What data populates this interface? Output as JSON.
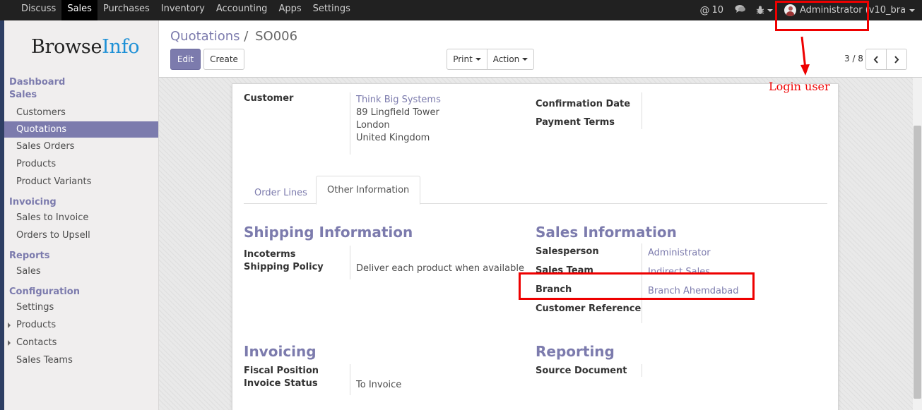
{
  "topbar": {
    "menu": [
      "Discuss",
      "Sales",
      "Purchases",
      "Inventory",
      "Accounting",
      "Apps",
      "Settings"
    ],
    "active_menu": "Sales",
    "mentions_count": "10",
    "user_name": "Administrator (v10_bra…"
  },
  "brand": {
    "part1": "Browse",
    "part2": "Info"
  },
  "sidebar": {
    "sections": [
      {
        "title": "Dashboard",
        "items": []
      },
      {
        "title": "Sales",
        "items": [
          "Customers",
          "Quotations",
          "Sales Orders",
          "Products",
          "Product Variants"
        ]
      },
      {
        "title": "Invoicing",
        "items": [
          "Sales to Invoice",
          "Orders to Upsell"
        ]
      },
      {
        "title": "Reports",
        "items": [
          "Sales"
        ]
      },
      {
        "title": "Configuration",
        "items": [
          "Settings",
          "Products",
          "Contacts",
          "Sales Teams"
        ]
      }
    ],
    "active_item": "Quotations"
  },
  "control_panel": {
    "breadcrumb_parent": "Quotations",
    "breadcrumb_sep": "/",
    "breadcrumb_current": "SO006",
    "edit_label": "Edit",
    "create_label": "Create",
    "print_label": "Print",
    "action_label": "Action",
    "pager": "3 / 8"
  },
  "form": {
    "customer_label": "Customer",
    "customer_name": "Think Big Systems",
    "customer_address": [
      "89 Lingfield Tower",
      "London",
      "United Kingdom"
    ],
    "confirmation_date_label": "Confirmation Date",
    "payment_terms_label": "Payment Terms",
    "tabs": [
      "Order Lines",
      "Other Information"
    ],
    "active_tab": "Other Information",
    "shipping": {
      "title": "Shipping Information",
      "incoterms_label": "Incoterms",
      "shipping_policy_label": "Shipping Policy",
      "shipping_policy_value": "Deliver each product when available"
    },
    "sales": {
      "title": "Sales Information",
      "salesperson_label": "Salesperson",
      "salesperson_value": "Administrator",
      "sales_team_label": "Sales Team",
      "sales_team_value": "Indirect Sales",
      "branch_label": "Branch",
      "branch_value": "Branch Ahemdabad",
      "customer_reference_label": "Customer Reference"
    },
    "invoicing": {
      "title": "Invoicing",
      "fiscal_position_label": "Fiscal Position",
      "invoice_status_label": "Invoice Status",
      "invoice_status_value": "To Invoice"
    },
    "reporting": {
      "title": "Reporting",
      "source_document_label": "Source Document"
    }
  },
  "annotation": {
    "text": "Login user",
    "color": "#e00000"
  }
}
